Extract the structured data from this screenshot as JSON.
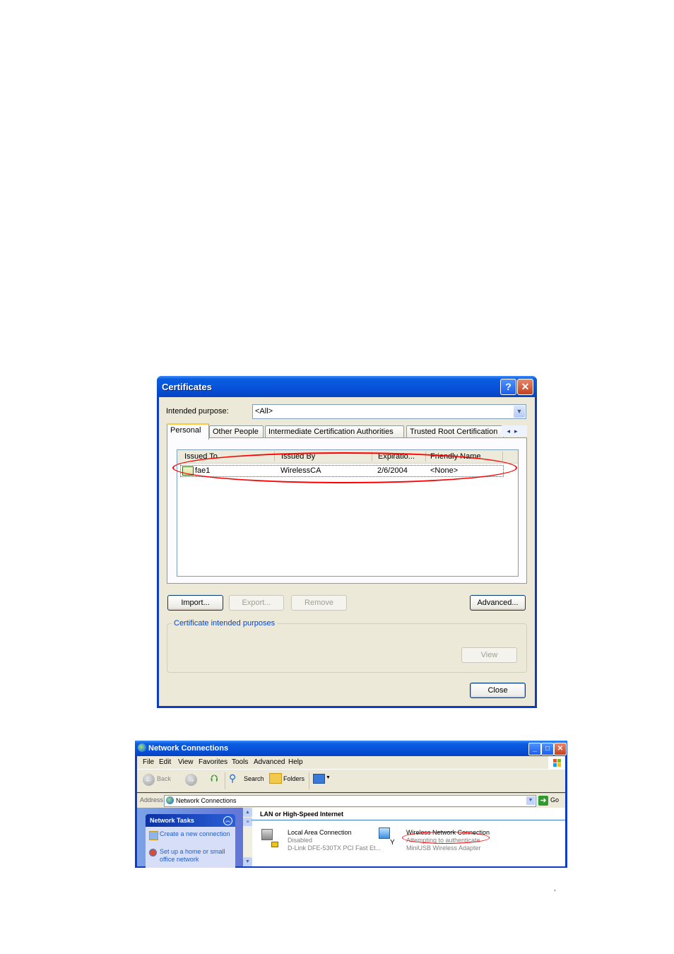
{
  "certificates_dialog": {
    "title": "Certificates",
    "help_label": "?",
    "close_label": "✕",
    "intended_purpose": {
      "label": "Intended purpose:",
      "label_mnemonic": "n",
      "value": "<All>"
    },
    "tabs": [
      {
        "label": "Personal",
        "active": true
      },
      {
        "label": "Other People",
        "active": false
      },
      {
        "label": "Intermediate Certification Authorities",
        "active": false
      },
      {
        "label": "Trusted Root Certification",
        "active": false
      }
    ],
    "tab_scroll": {
      "left": "◂",
      "right": "▸"
    },
    "list": {
      "columns": [
        "Issued To",
        "Issued By",
        "Expiratio...",
        "Friendly Name"
      ],
      "rows": [
        {
          "issued_to": "fae1",
          "issued_by": "WirelessCA",
          "expiration": "2/6/2004",
          "friendly_name": "<None>",
          "icon": "certificate-icon"
        }
      ]
    },
    "buttons": {
      "import": "Import...",
      "export": "Export...",
      "remove": "Remove",
      "advanced": "Advanced...",
      "view": "View",
      "close": "Close"
    },
    "group_legend": "Certificate intended purposes",
    "highlight_color": "#ff0000"
  },
  "network_window": {
    "title": "Network Connections",
    "window_buttons": {
      "minimize": "_",
      "maximize": "□",
      "close": "✕"
    },
    "menu": [
      "File",
      "Edit",
      "View",
      "Favorites",
      "Tools",
      "Advanced",
      "Help"
    ],
    "toolbar": {
      "back": "Back",
      "search": "Search",
      "folders": "Folders"
    },
    "address": {
      "label": "Address",
      "value": "Network Connections",
      "go": "Go"
    },
    "tasks": {
      "header": "Network Tasks",
      "items": [
        {
          "label": "Create a new connection",
          "icon": "new-connection-icon"
        },
        {
          "label": "Set up a home or small office network",
          "icon": "home-network-icon"
        }
      ]
    },
    "group_header": "LAN or High-Speed Internet",
    "connections": [
      {
        "name": "Local Area Connection",
        "status": "Disabled",
        "device": "D-Link DFE-530TX PCI Fast Et..."
      },
      {
        "name": "Wireless Network Connection",
        "status": "Attempting to authenticate",
        "device": "MiniUSB Wireless Adapter"
      }
    ]
  },
  "footer_mark": ","
}
